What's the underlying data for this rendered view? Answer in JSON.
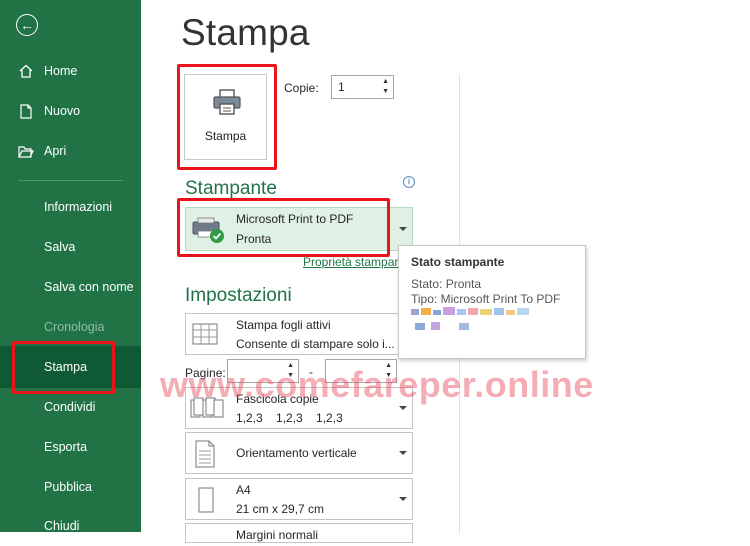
{
  "sidebar": {
    "items": [
      {
        "label": "Home"
      },
      {
        "label": "Nuovo"
      },
      {
        "label": "Apri"
      },
      {
        "label": "Informazioni"
      },
      {
        "label": "Salva"
      },
      {
        "label": "Salva con nome"
      },
      {
        "label": "Cronologia"
      },
      {
        "label": "Stampa"
      },
      {
        "label": "Condividi"
      },
      {
        "label": "Esporta"
      },
      {
        "label": "Pubblica"
      },
      {
        "label": "Chiudi"
      }
    ]
  },
  "main": {
    "title": "Stampa",
    "print_button_label": "Stampa",
    "copies_label": "Copie:",
    "copies_value": "1",
    "printer_section": "Stampante",
    "printer_name": "Microsoft Print to PDF",
    "printer_status": "Pronta",
    "printer_properties_link": "Proprietà stampante",
    "settings_section": "Impostazioni",
    "settings": {
      "sheets_title": "Stampa fogli attivi",
      "sheets_desc": "Consente di stampare solo i...",
      "pages_label": "Pagine:",
      "pages_dash": "-",
      "collate_title": "Fascicola copie",
      "collate_desc": "1,2,3    1,2,3    1,2,3",
      "orientation": "Orientamento verticale",
      "paper_title": "A4",
      "paper_desc": "21 cm x 29,7 cm",
      "margins_title": "Margini normali"
    }
  },
  "tooltip": {
    "title": "Stato stampante",
    "status": "Stato: Pronta",
    "type": "Tipo: Microsoft Print To PDF"
  },
  "watermark": "www.comefareper.online",
  "colors": {
    "brand": "#217346",
    "highlight": "#e8141a"
  }
}
